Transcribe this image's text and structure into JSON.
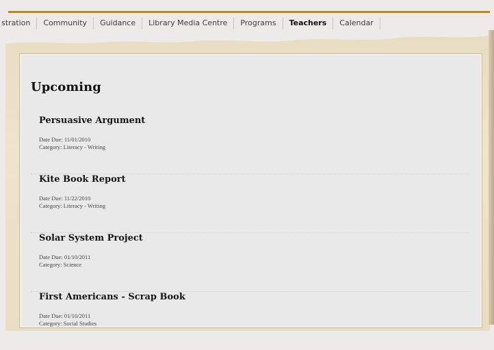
{
  "nav": {
    "items": [
      {
        "label": "stration"
      },
      {
        "label": "Community"
      },
      {
        "label": "Guidance"
      },
      {
        "label": "Library Media Centre"
      },
      {
        "label": "Programs"
      },
      {
        "label": "Teachers",
        "active": true
      },
      {
        "label": "Calendar"
      }
    ]
  },
  "main": {
    "heading": "Upcoming",
    "items": [
      {
        "title": "Persuasive Argument",
        "date_due": "Date Due: 11/01/2010",
        "category": "Category: Literacy - Writing"
      },
      {
        "title": "Kite Book Report",
        "date_due": "Date Due: 11/22/2010",
        "category": "Category: Literacy - Writing"
      },
      {
        "title": "Solar System Project",
        "date_due": "Date Due: 01/10/2011",
        "category": "Category: Science"
      },
      {
        "title": "First Americans - Scrap Book",
        "date_due": "Date Due: 01/10/2011",
        "category": "Category: Social Studies"
      }
    ]
  },
  "colors": {
    "accent_rule": "#b8871f",
    "parchment": "#e8dcc2",
    "panel": "#e9e9e9"
  }
}
